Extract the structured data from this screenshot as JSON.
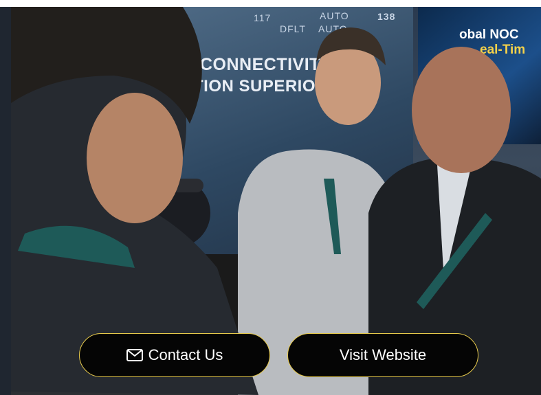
{
  "photo": {
    "backdrop_lines": [
      "CONNECTIVIT",
      "TION SUPERIORI"
    ],
    "hud_readouts": [
      "117",
      "AUTO",
      "138",
      "DFLT",
      "AUTO"
    ],
    "tv_lines": [
      "obal NOC",
      "eal-Tim"
    ]
  },
  "buttons": {
    "contact_label": "Contact Us",
    "contact_icon": "envelope-icon",
    "visit_label": "Visit Website",
    "border_color": "#e6c94b",
    "background": "#050505"
  }
}
